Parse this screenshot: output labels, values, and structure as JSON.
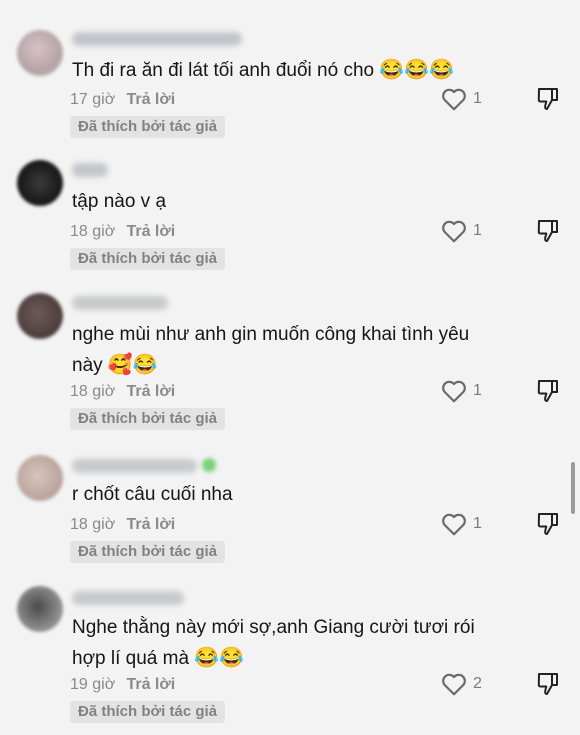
{
  "comments": [
    {
      "text": "Th đi ra ăn đi lát tối anh đuổi nó cho",
      "emoji": "😂😂😂",
      "time": "17 giờ",
      "reply": "Trả lời",
      "likes": "1",
      "badge": "Đã thích bởi tác giả"
    },
    {
      "text": "tập nào v ạ",
      "emoji": "",
      "time": "18 giờ",
      "reply": "Trả lời",
      "likes": "1",
      "badge": "Đã thích bởi tác giả"
    },
    {
      "text": "nghe mùi như anh gin muốn công khai tình yêu này",
      "emoji": "🥰😂",
      "time": "18 giờ",
      "reply": "Trả lời",
      "likes": "1",
      "badge": "Đã thích bởi tác giả"
    },
    {
      "text": "r chốt câu cuối nha",
      "emoji": "",
      "time": "18 giờ",
      "reply": "Trả lời",
      "likes": "1",
      "badge": "Đã thích bởi tác giả"
    },
    {
      "text": "Nghe thằng này mới sợ,anh Giang cười tươi rói hợp lí quá mà",
      "emoji": "😂😂",
      "time": "19 giờ",
      "reply": "Trả lời",
      "likes": "2",
      "badge": "Đã thích bởi tác giả"
    }
  ],
  "colors": {
    "background": "#f3f3f3",
    "badge_bg": "#e3e3e3",
    "meta": "#8a8a8a"
  },
  "icons": {
    "like": "heart-outline-icon",
    "dislike": "thumbs-down-outline-icon"
  }
}
